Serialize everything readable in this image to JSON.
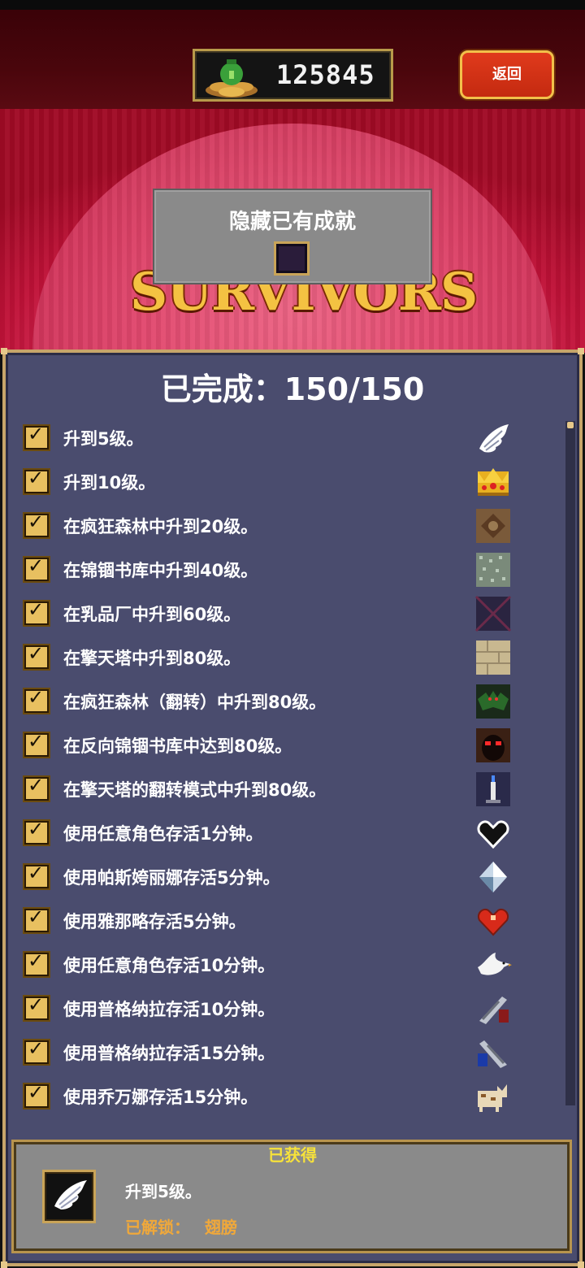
{
  "header": {
    "coin_count": "125845",
    "back_label": "返回"
  },
  "filter": {
    "hide_label": "隐藏已有成就",
    "hide_checked": false
  },
  "logo": {
    "text": "SURVIVORS"
  },
  "progress": {
    "label": "已完成：150/150"
  },
  "achievements": [
    {
      "text": "升到5级。",
      "icon": "wing-icon",
      "done": true
    },
    {
      "text": "升到10级。",
      "icon": "crown-icon",
      "done": true
    },
    {
      "text": "在疯狂森林中升到20级。",
      "icon": "forest-tile-icon",
      "done": true
    },
    {
      "text": "在锦锢书库中升到40级。",
      "icon": "library-tile-icon",
      "done": true
    },
    {
      "text": "在乳品厂中升到60级。",
      "icon": "dairy-tile-icon",
      "done": true
    },
    {
      "text": "在擎天塔中升到80级。",
      "icon": "tower-tile-icon",
      "done": true
    },
    {
      "text": "在疯狂森林（翻转）中升到80级。",
      "icon": "bat-icon",
      "done": true
    },
    {
      "text": "在反向锦锢书库中达到80级。",
      "icon": "red-eyes-icon",
      "done": true
    },
    {
      "text": "在擎天塔的翻转模式中升到80级。",
      "icon": "candle-icon",
      "done": true
    },
    {
      "text": "使用任意角色存活1分钟。",
      "icon": "black-heart-icon",
      "done": true
    },
    {
      "text": "使用帕斯姱丽娜存活5分钟。",
      "icon": "diamond-icon",
      "done": true
    },
    {
      "text": "使用雅那略存活5分钟。",
      "icon": "red-heart-icon",
      "done": true
    },
    {
      "text": "使用任意角色存活10分钟。",
      "icon": "dove-icon",
      "done": true
    },
    {
      "text": "使用普格纳拉存活10分钟。",
      "icon": "gun-red-icon",
      "done": true
    },
    {
      "text": "使用普格纳拉存活15分钟。",
      "icon": "gun-blue-icon",
      "done": true
    },
    {
      "text": "使用乔万娜存活15分钟。",
      "icon": "cat-icon",
      "done": true
    }
  ],
  "detail": {
    "title": "已获得",
    "name": "升到5级。",
    "unlock_label": "已解锁：",
    "unlock_value": "翅膀",
    "icon": "wing-icon"
  },
  "colors": {
    "panel": "#4a4c6e",
    "gold_border": "#c7a56a",
    "check_fill": "#e8c060",
    "detail_title": "#f7e23a",
    "unlock_text": "#f0a83a"
  }
}
